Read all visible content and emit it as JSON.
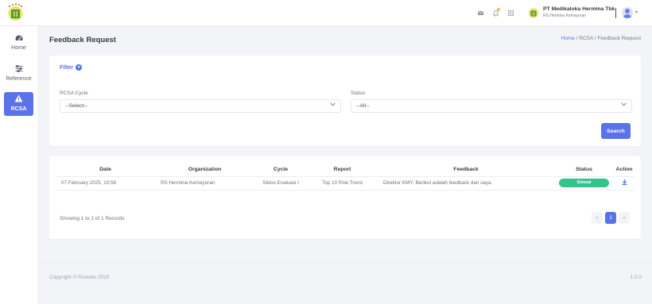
{
  "header": {
    "company_name": "PT Medikaloka Hermina Tbk",
    "company_sub": "RS Hermina Kemayoran"
  },
  "sidebar": {
    "items": [
      {
        "label": "Home",
        "icon": "dashboard-icon"
      },
      {
        "label": "Reference",
        "icon": "sliders-icon"
      },
      {
        "label": "RCSA",
        "icon": "warning-icon",
        "active": true
      }
    ]
  },
  "page": {
    "title": "Feedback Request",
    "breadcrumb": [
      "Home",
      "RCSA",
      "Feedback Request"
    ]
  },
  "filter": {
    "title": "Filter",
    "cycle_label": "RCSA Cycle",
    "cycle_value": "--Select--",
    "status_label": "Status",
    "status_value": "--All--",
    "search_label": "Search"
  },
  "table": {
    "columns": [
      "Date",
      "Organization",
      "Cycle",
      "Report",
      "Feedback",
      "Status",
      "Action"
    ],
    "rows": [
      {
        "date": "07 February 2025, 10:56",
        "organization": "RS Hermina Kemayoran",
        "cycle": "Siklus Evaluasi I",
        "report": "Top 10 Risk Trend",
        "feedback": "Direktur KMY: Berikut adalah feedback dari saya.",
        "status": "Selesai"
      }
    ],
    "records_text": "Showing 1 to 1 of 1 Records",
    "pager": {
      "prev": "«",
      "current": "1",
      "next": "»"
    }
  },
  "footer": {
    "copyright": "Copyright © Riskobs 2025",
    "version": "1.0.0"
  },
  "colors": {
    "primary": "#5b73e8",
    "success": "#34c38f",
    "background": "#f3f4f8"
  }
}
